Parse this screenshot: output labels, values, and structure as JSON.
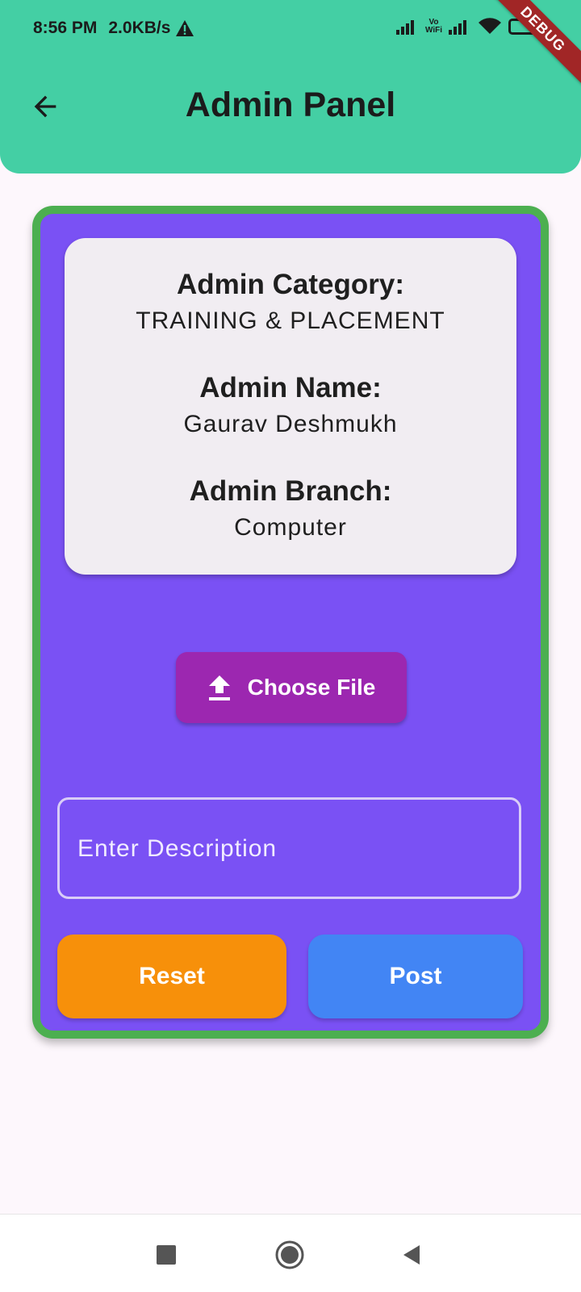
{
  "status_bar": {
    "time": "8:56 PM",
    "speed": "2.0KB/s",
    "vowifi_top": "Vo",
    "vowifi_bottom": "WiFi"
  },
  "debug_banner": "DEBUG",
  "header": {
    "title": "Admin Panel",
    "background": "#44cfa4"
  },
  "info": {
    "category_label": "Admin Category:",
    "category_value": "TRAINING & PLACEMENT",
    "name_label": "Admin Name:",
    "name_value": "Gaurav Deshmukh",
    "branch_label": "Admin Branch:",
    "branch_value": "Computer"
  },
  "actions": {
    "choose_file_label": "Choose File",
    "description_placeholder": "Enter Description",
    "reset_label": "Reset",
    "post_label": "Post"
  },
  "colors": {
    "card": "#7a51f4",
    "card_border": "#4caf50",
    "choose_file": "#9c27b0",
    "reset": "#f7900a",
    "post": "#4285f4"
  },
  "icons": {
    "back": "arrow-left-icon",
    "upload": "upload-icon",
    "nav_recents": "square-icon",
    "nav_home": "circle-icon",
    "nav_back": "triangle-back-icon"
  }
}
